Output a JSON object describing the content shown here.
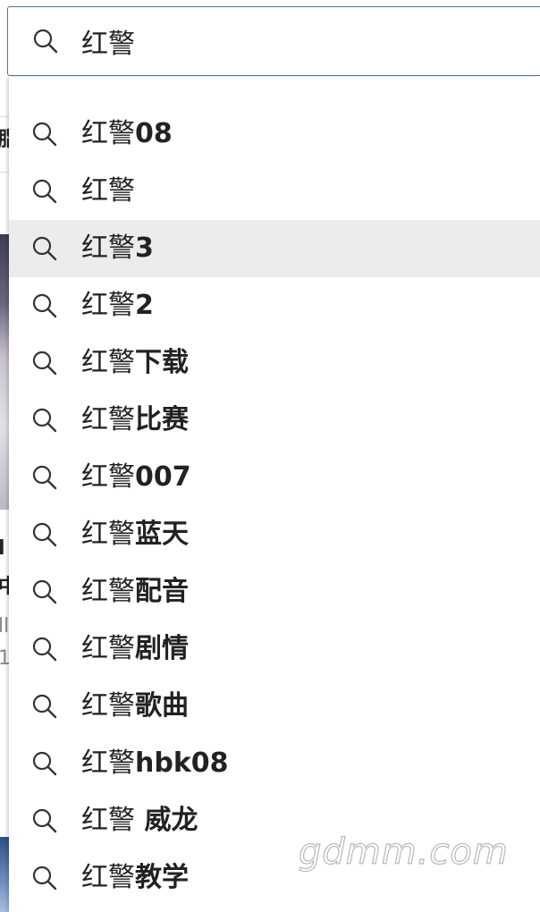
{
  "search": {
    "query": "红警",
    "icon": "search-icon"
  },
  "suggestions": [
    {
      "prefix": "红警",
      "rest": "08",
      "highlighted": false
    },
    {
      "prefix": "红警",
      "rest": "",
      "highlighted": false
    },
    {
      "prefix": "红警",
      "rest": "3",
      "highlighted": true
    },
    {
      "prefix": "红警",
      "rest": "2",
      "highlighted": false
    },
    {
      "prefix": "红警",
      "rest": "下载",
      "highlighted": false
    },
    {
      "prefix": "红警",
      "rest": "比赛",
      "highlighted": false
    },
    {
      "prefix": "红警",
      "rest": "007",
      "highlighted": false
    },
    {
      "prefix": "红警",
      "rest": "蓝天",
      "highlighted": false
    },
    {
      "prefix": "红警",
      "rest": "配音",
      "highlighted": false
    },
    {
      "prefix": "红警",
      "rest": "剧情",
      "highlighted": false
    },
    {
      "prefix": "红警",
      "rest": "歌曲",
      "highlighted": false
    },
    {
      "prefix": "红警",
      "rest": "hbk08",
      "highlighted": false
    },
    {
      "prefix": "红警",
      "rest": " 威龙",
      "highlighted": false
    },
    {
      "prefix": "红警",
      "rest": "教学",
      "highlighted": false
    }
  ],
  "background_page": {
    "visible_fragments": [
      "脂",
      "l",
      "中",
      "ll",
      "1"
    ]
  },
  "watermark": {
    "text": "gdmm.com"
  },
  "colors": {
    "search_border": "#4a6fb3",
    "highlight_row": "#ececec",
    "text": "#222222",
    "icon": "#333333"
  }
}
